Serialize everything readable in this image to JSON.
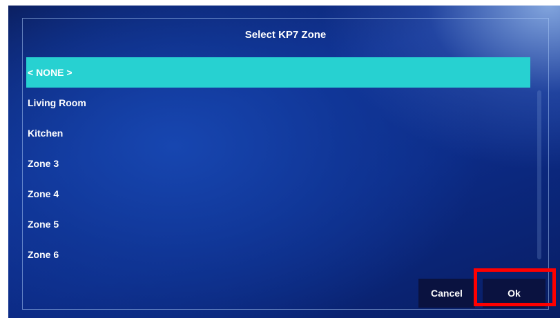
{
  "dialog": {
    "title": "Select KP7 Zone"
  },
  "zone_list": {
    "selected_index": 0,
    "items": [
      {
        "label": "< NONE >"
      },
      {
        "label": "Living Room"
      },
      {
        "label": "Kitchen"
      },
      {
        "label": "Zone 3"
      },
      {
        "label": "Zone 4"
      },
      {
        "label": "Zone 5"
      },
      {
        "label": "Zone 6"
      }
    ]
  },
  "buttons": {
    "cancel_label": "Cancel",
    "ok_label": "Ok"
  },
  "colors": {
    "selection": "#27d1d1",
    "button_bg": "#0a1240",
    "highlight": "#ff0000"
  }
}
